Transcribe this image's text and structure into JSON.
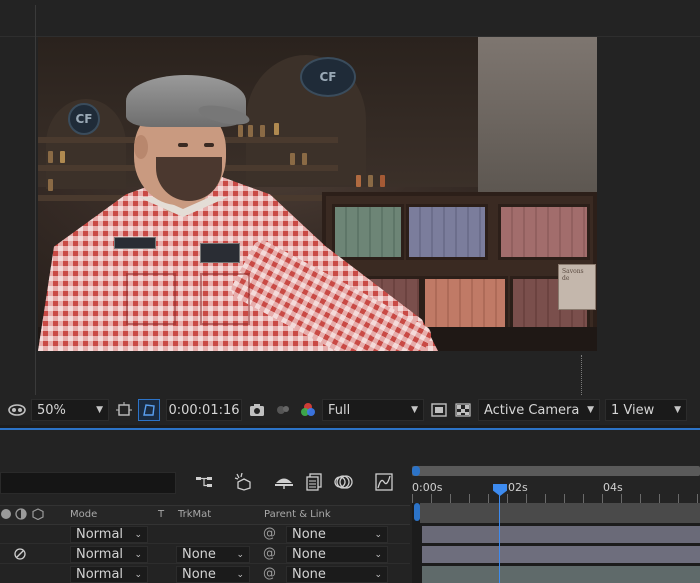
{
  "viewer_toolbar": {
    "zoom": "50%",
    "timecode": "0:00:01:16",
    "resolution": "Full",
    "camera": "Active Camera",
    "views": "1 View"
  },
  "scene": {
    "emblem_text": "CF",
    "sign_text": "Savons de"
  },
  "timeline": {
    "columns": {
      "mode": "Mode",
      "t": "T",
      "trkmat": "TrkMat",
      "parent": "Parent & Link"
    },
    "layers": [
      {
        "mode": "Normal",
        "trkmat": "",
        "parent": "None"
      },
      {
        "mode": "Normal",
        "trkmat": "None",
        "parent": "None"
      },
      {
        "mode": "Normal",
        "trkmat": "None",
        "parent": "None"
      }
    ],
    "ruler": {
      "ticks": [
        "0:00s",
        "02s",
        "04s"
      ]
    }
  },
  "colors": {
    "accent": "#2c73c7",
    "playhead": "#3d8bf0",
    "panel_bg": "#232323"
  }
}
